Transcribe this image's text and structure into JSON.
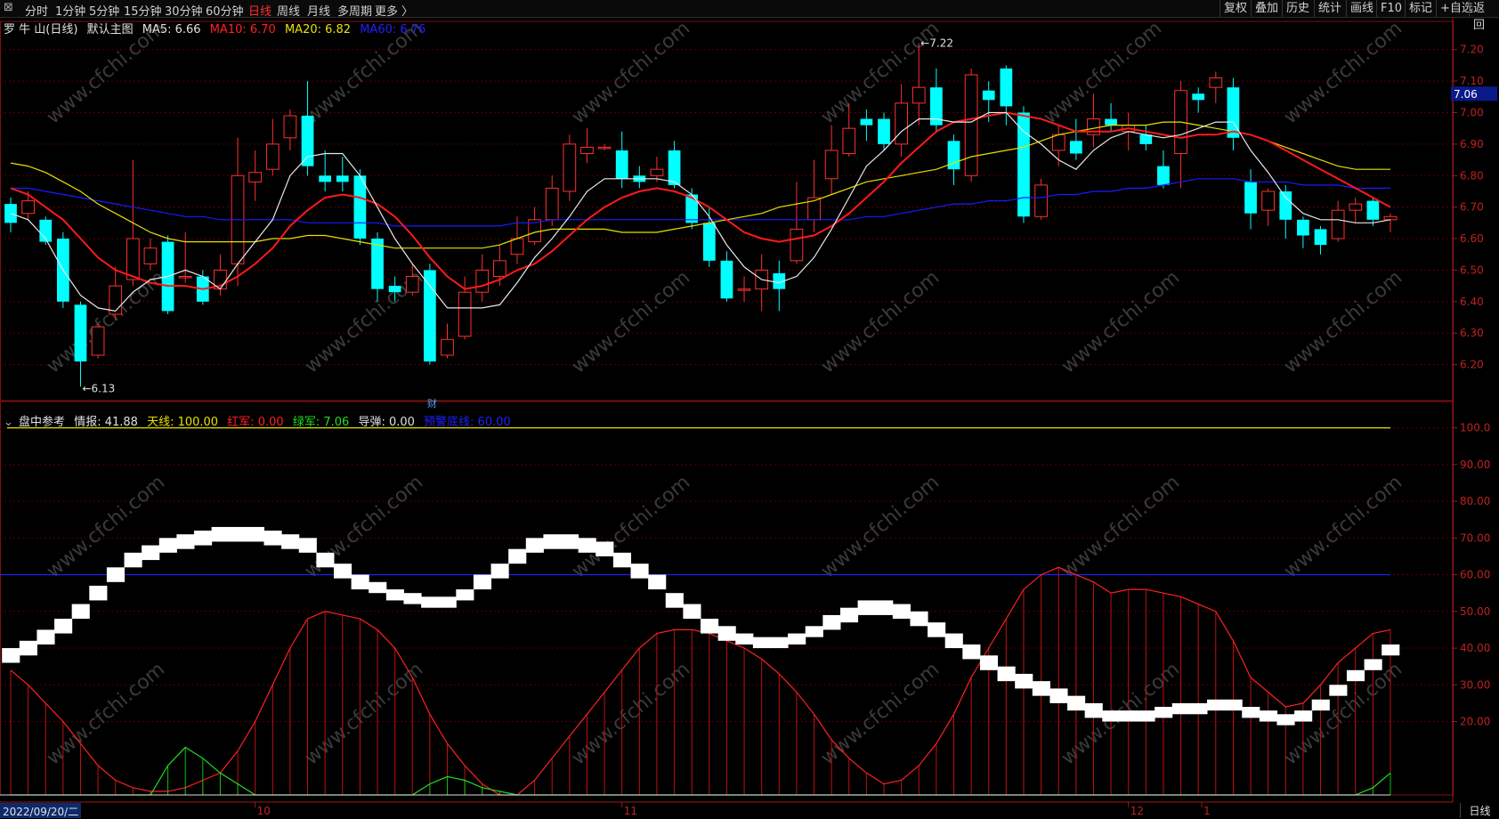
{
  "toolbar": {
    "close_glyph": "⊠",
    "periods": [
      "分时",
      "1分钟",
      "5分钟",
      "15分钟",
      "30分钟",
      "60分钟",
      "日线",
      "周线",
      "月线",
      "多周期",
      "更多 〉"
    ],
    "active_period": "日线",
    "right_buttons": [
      "复权",
      "叠加",
      "历史",
      "统计",
      "画线",
      "F10",
      "标记",
      "+自选",
      "返回"
    ]
  },
  "main_panel": {
    "stock_name": "罗 牛 山(日线)",
    "template_label": "默认主图",
    "ma5": {
      "label": "MA5: 6.66",
      "color": "#e0e0e0"
    },
    "ma10": {
      "label": "MA10: 6.70",
      "color": "#ff2020"
    },
    "ma20": {
      "label": "MA20: 6.82",
      "color": "#e8e000"
    },
    "ma60": {
      "label": "MA60: 6.76",
      "color": "#2020ff"
    },
    "high_marker": "7.22",
    "low_marker": "6.13",
    "price_tag": "7.06",
    "cai_marker": "财",
    "y_ticks": [
      "7.20",
      "7.10",
      "7.00",
      "6.90",
      "6.80",
      "6.70",
      "6.60",
      "6.50",
      "6.40",
      "6.30",
      "6.20"
    ],
    "watermark": "www.cfchi.com"
  },
  "sub_panel": {
    "title": "盘中参考",
    "info": {
      "label": "情报: 41.88",
      "color": "#e0e0e0"
    },
    "sky": {
      "label": "天线: 100.00",
      "color": "#e8e000"
    },
    "red": {
      "label": "红军: 0.00",
      "color": "#ff2020"
    },
    "green": {
      "label": "绿军: 7.06",
      "color": "#20e020"
    },
    "missile": {
      "label": "导弹: 0.00",
      "color": "#e0e0e0"
    },
    "warn": {
      "label": "预警底线: 60.00",
      "color": "#2020ff"
    },
    "y_ticks": [
      "100.0",
      "90.00",
      "80.00",
      "70.00",
      "60.00",
      "50.00",
      "40.00",
      "30.00",
      "20.00"
    ]
  },
  "x_axis": {
    "date_label": "2022/09/20/二",
    "months": [
      "10",
      "11",
      "12",
      "1"
    ],
    "bottom_tab": "日线"
  },
  "chart_data": {
    "type": "candlestick",
    "ylim": [
      6.1,
      7.25
    ],
    "candles": [
      [
        6.71,
        6.65,
        6.73,
        6.62
      ],
      [
        6.68,
        6.72,
        6.75,
        6.66
      ],
      [
        6.66,
        6.59,
        6.67,
        6.58
      ],
      [
        6.6,
        6.4,
        6.62,
        6.38
      ],
      [
        6.39,
        6.21,
        6.4,
        6.13
      ],
      [
        6.23,
        6.32,
        6.33,
        6.22
      ],
      [
        6.36,
        6.45,
        6.51,
        6.34
      ],
      [
        6.47,
        6.6,
        6.85,
        6.45
      ],
      [
        6.52,
        6.57,
        6.6,
        6.5
      ],
      [
        6.59,
        6.37,
        6.61,
        6.36
      ],
      [
        6.48,
        6.48,
        6.62,
        6.46
      ],
      [
        6.48,
        6.4,
        6.5,
        6.39
      ],
      [
        6.44,
        6.5,
        6.55,
        6.42
      ],
      [
        6.52,
        6.8,
        6.92,
        6.45
      ],
      [
        6.78,
        6.81,
        6.88,
        6.72
      ],
      [
        6.82,
        6.9,
        6.98,
        6.8
      ],
      [
        6.92,
        6.99,
        7.01,
        6.88
      ],
      [
        6.99,
        6.83,
        7.1,
        6.8
      ],
      [
        6.8,
        6.78,
        6.88,
        6.75
      ],
      [
        6.8,
        6.78,
        6.86,
        6.75
      ],
      [
        6.8,
        6.6,
        6.82,
        6.58
      ],
      [
        6.6,
        6.44,
        6.62,
        6.4
      ],
      [
        6.45,
        6.43,
        6.48,
        6.4
      ],
      [
        6.43,
        6.48,
        6.52,
        6.42
      ],
      [
        6.5,
        6.21,
        6.52,
        6.2
      ],
      [
        6.23,
        6.28,
        6.33,
        6.22
      ],
      [
        6.29,
        6.43,
        6.48,
        6.28
      ],
      [
        6.43,
        6.5,
        6.55,
        6.4
      ],
      [
        6.48,
        6.53,
        6.58,
        6.45
      ],
      [
        6.55,
        6.6,
        6.67,
        6.52
      ],
      [
        6.59,
        6.66,
        6.7,
        6.58
      ],
      [
        6.66,
        6.76,
        6.8,
        6.64
      ],
      [
        6.75,
        6.9,
        6.93,
        6.72
      ],
      [
        6.87,
        6.89,
        6.95,
        6.84
      ],
      [
        6.89,
        6.89,
        6.9,
        6.88
      ],
      [
        6.88,
        6.79,
        6.94,
        6.76
      ],
      [
        6.8,
        6.78,
        6.83,
        6.76
      ],
      [
        6.8,
        6.82,
        6.86,
        6.78
      ],
      [
        6.88,
        6.77,
        6.91,
        6.76
      ],
      [
        6.74,
        6.65,
        6.76,
        6.63
      ],
      [
        6.65,
        6.53,
        6.7,
        6.51
      ],
      [
        6.53,
        6.41,
        6.56,
        6.4
      ],
      [
        6.44,
        6.44,
        6.48,
        6.4
      ],
      [
        6.44,
        6.5,
        6.55,
        6.37
      ],
      [
        6.49,
        6.44,
        6.53,
        6.37
      ],
      [
        6.53,
        6.63,
        6.78,
        6.52
      ],
      [
        6.66,
        6.73,
        6.85,
        6.62
      ],
      [
        6.79,
        6.88,
        6.96,
        6.74
      ],
      [
        6.87,
        6.95,
        7.03,
        6.86
      ],
      [
        6.98,
        6.96,
        7.01,
        6.91
      ],
      [
        6.98,
        6.9,
        7.0,
        6.88
      ],
      [
        6.9,
        7.03,
        7.09,
        6.86
      ],
      [
        7.03,
        7.08,
        7.22,
        6.96
      ],
      [
        7.08,
        6.96,
        7.14,
        6.94
      ],
      [
        6.91,
        6.82,
        6.93,
        6.77
      ],
      [
        6.8,
        7.12,
        7.14,
        6.78
      ],
      [
        7.07,
        7.04,
        7.1,
        6.97
      ],
      [
        7.14,
        7.02,
        7.15,
        6.96
      ],
      [
        7.0,
        6.67,
        7.02,
        6.65
      ],
      [
        6.67,
        6.77,
        6.79,
        6.66
      ],
      [
        6.88,
        6.93,
        6.96,
        6.83
      ],
      [
        6.91,
        6.87,
        6.98,
        6.85
      ],
      [
        6.93,
        6.98,
        7.06,
        6.89
      ],
      [
        6.98,
        6.96,
        7.03,
        6.94
      ],
      [
        6.94,
        6.96,
        7.0,
        6.88
      ],
      [
        6.93,
        6.9,
        6.96,
        6.88
      ],
      [
        6.83,
        6.77,
        6.88,
        6.76
      ],
      [
        6.87,
        7.07,
        7.1,
        6.76
      ],
      [
        7.06,
        7.04,
        7.08,
        7.0
      ],
      [
        7.08,
        7.11,
        7.13,
        7.03
      ],
      [
        7.08,
        6.92,
        7.11,
        6.88
      ],
      [
        6.78,
        6.68,
        6.82,
        6.63
      ],
      [
        6.69,
        6.75,
        6.76,
        6.64
      ],
      [
        6.75,
        6.66,
        6.77,
        6.6
      ],
      [
        6.66,
        6.61,
        6.67,
        6.57
      ],
      [
        6.63,
        6.58,
        6.64,
        6.55
      ],
      [
        6.6,
        6.69,
        6.72,
        6.59
      ],
      [
        6.69,
        6.71,
        6.73,
        6.65
      ],
      [
        6.72,
        6.66,
        6.73,
        6.64
      ],
      [
        6.66,
        6.67,
        6.68,
        6.62
      ]
    ],
    "ma5": [
      6.68,
      6.66,
      6.6,
      6.5,
      6.42,
      6.38,
      6.37,
      6.43,
      6.47,
      6.48,
      6.5,
      6.48,
      6.44,
      6.52,
      6.59,
      6.66,
      6.8,
      6.86,
      6.87,
      6.87,
      6.8,
      6.7,
      6.6,
      6.52,
      6.45,
      6.38,
      6.38,
      6.38,
      6.39,
      6.46,
      6.54,
      6.6,
      6.67,
      6.75,
      6.79,
      6.79,
      6.79,
      6.79,
      6.78,
      6.74,
      6.67,
      6.58,
      6.51,
      6.47,
      6.46,
      6.48,
      6.54,
      6.63,
      6.73,
      6.83,
      6.88,
      6.94,
      6.98,
      6.98,
      6.97,
      6.97,
      7.0,
      7.0,
      6.94,
      6.9,
      6.85,
      6.82,
      6.88,
      6.92,
      6.94,
      6.93,
      6.92,
      6.93,
      6.95,
      6.97,
      6.97,
      6.88,
      6.81,
      6.73,
      6.68,
      6.66,
      6.66,
      6.65,
      6.65,
      6.66
    ],
    "ma10": [
      6.76,
      6.74,
      6.7,
      6.66,
      6.6,
      6.54,
      6.5,
      6.48,
      6.46,
      6.45,
      6.45,
      6.44,
      6.45,
      6.48,
      6.52,
      6.57,
      6.64,
      6.69,
      6.73,
      6.74,
      6.73,
      6.71,
      6.67,
      6.61,
      6.54,
      6.48,
      6.44,
      6.45,
      6.47,
      6.5,
      6.52,
      6.56,
      6.61,
      6.66,
      6.7,
      6.73,
      6.75,
      6.76,
      6.75,
      6.73,
      6.7,
      6.66,
      6.62,
      6.6,
      6.59,
      6.6,
      6.61,
      6.64,
      6.68,
      6.73,
      6.78,
      6.84,
      6.89,
      6.94,
      6.97,
      6.98,
      6.99,
      7.0,
      6.99,
      6.98,
      6.96,
      6.94,
      6.94,
      6.94,
      6.95,
      6.94,
      6.93,
      6.92,
      6.93,
      6.93,
      6.94,
      6.93,
      6.91,
      6.88,
      6.85,
      6.82,
      6.79,
      6.76,
      6.73,
      6.7
    ],
    "ma20": [
      6.84,
      6.83,
      6.81,
      6.78,
      6.75,
      6.71,
      6.68,
      6.65,
      6.62,
      6.6,
      6.59,
      6.59,
      6.59,
      6.59,
      6.59,
      6.6,
      6.6,
      6.61,
      6.61,
      6.6,
      6.59,
      6.58,
      6.57,
      6.57,
      6.57,
      6.57,
      6.57,
      6.57,
      6.58,
      6.6,
      6.62,
      6.63,
      6.63,
      6.63,
      6.63,
      6.62,
      6.62,
      6.62,
      6.63,
      6.64,
      6.65,
      6.66,
      6.67,
      6.68,
      6.7,
      6.71,
      6.72,
      6.74,
      6.76,
      6.78,
      6.79,
      6.8,
      6.81,
      6.82,
      6.84,
      6.86,
      6.87,
      6.88,
      6.89,
      6.91,
      6.93,
      6.94,
      6.95,
      6.96,
      6.96,
      6.96,
      6.97,
      6.97,
      6.96,
      6.95,
      6.94,
      6.93,
      6.91,
      6.89,
      6.87,
      6.85,
      6.83,
      6.82,
      6.82,
      6.82
    ],
    "ma60": [
      6.76,
      6.76,
      6.75,
      6.74,
      6.73,
      6.72,
      6.71,
      6.7,
      6.69,
      6.68,
      6.67,
      6.67,
      6.66,
      6.66,
      6.66,
      6.66,
      6.66,
      6.65,
      6.65,
      6.65,
      6.65,
      6.65,
      6.64,
      6.64,
      6.64,
      6.64,
      6.64,
      6.64,
      6.64,
      6.65,
      6.65,
      6.66,
      6.66,
      6.66,
      6.66,
      6.66,
      6.66,
      6.66,
      6.66,
      6.66,
      6.66,
      6.66,
      6.66,
      6.66,
      6.66,
      6.66,
      6.66,
      6.66,
      6.66,
      6.67,
      6.67,
      6.68,
      6.69,
      6.7,
      6.71,
      6.71,
      6.72,
      6.72,
      6.73,
      6.73,
      6.74,
      6.74,
      6.75,
      6.75,
      6.76,
      6.76,
      6.77,
      6.78,
      6.79,
      6.79,
      6.79,
      6.78,
      6.78,
      6.78,
      6.77,
      6.77,
      6.77,
      6.76,
      6.76,
      6.76
    ],
    "sub_ylim": [
      0,
      105
    ],
    "band_upper": [
      40,
      42,
      45,
      48,
      52,
      57,
      62,
      66,
      68,
      70,
      71,
      72,
      73,
      73,
      73,
      72,
      71,
      70,
      66,
      63,
      60,
      58,
      56,
      55,
      54,
      54,
      56,
      60,
      63,
      67,
      70,
      71,
      71,
      70,
      69,
      66,
      63,
      60,
      55,
      52,
      48,
      46,
      44,
      43,
      43,
      44,
      46,
      49,
      51,
      53,
      53,
      52,
      50,
      47,
      44,
      41,
      38,
      35,
      33,
      31,
      29,
      27,
      25,
      23,
      23,
      23,
      24,
      25,
      25,
      26,
      26,
      24,
      23,
      22,
      23,
      26,
      30,
      34,
      37,
      41
    ],
    "band_lower": [
      36,
      38,
      41,
      44,
      48,
      53,
      58,
      62,
      64,
      66,
      67,
      68,
      69,
      69,
      69,
      68,
      67,
      66,
      62,
      59,
      56,
      55,
      53,
      52,
      51,
      51,
      53,
      56,
      59,
      63,
      66,
      67,
      67,
      66,
      65,
      62,
      59,
      56,
      51,
      48,
      44,
      42,
      41,
      40,
      40,
      41,
      43,
      45,
      47,
      49,
      49,
      48,
      46,
      43,
      40,
      37,
      34,
      31,
      29,
      27,
      25,
      23,
      21,
      20,
      20,
      20,
      21,
      22,
      22,
      23,
      23,
      21,
      20,
      19,
      20,
      23,
      27,
      31,
      34,
      38
    ],
    "red_line": [
      34,
      30,
      25,
      20,
      14,
      8,
      4,
      2,
      1,
      1,
      2,
      4,
      6,
      12,
      20,
      30,
      40,
      48,
      50,
      49,
      48,
      45,
      40,
      32,
      22,
      14,
      8,
      3,
      0,
      0,
      4,
      10,
      16,
      22,
      28,
      34,
      40,
      44,
      45,
      45,
      44,
      42,
      40,
      37,
      33,
      28,
      22,
      15,
      10,
      6,
      3,
      4,
      8,
      14,
      22,
      32,
      40,
      48,
      56,
      60,
      62,
      60,
      58,
      55,
      56,
      56,
      55,
      54,
      52,
      50,
      42,
      32,
      28,
      24,
      25,
      30,
      36,
      40,
      44,
      45
    ],
    "green_line": [
      0,
      0,
      0,
      0,
      0,
      0,
      0,
      0,
      0,
      8,
      13,
      10,
      6,
      3,
      0,
      0,
      0,
      0,
      0,
      0,
      0,
      0,
      0,
      0,
      3,
      5,
      4,
      2,
      1,
      0,
      0,
      0,
      0,
      0,
      0,
      0,
      0,
      0,
      0,
      0,
      0,
      0,
      0,
      0,
      0,
      0,
      0,
      0,
      0,
      0,
      0,
      0,
      0,
      0,
      0,
      0,
      0,
      0,
      0,
      0,
      0,
      0,
      0,
      0,
      0,
      0,
      0,
      0,
      0,
      0,
      0,
      0,
      0,
      0,
      0,
      0,
      0,
      0,
      2,
      6
    ],
    "sky_line": 100,
    "warn_line": 60
  },
  "colors": {
    "up": "#ff3030",
    "down": "#00ffff",
    "grid": "#5a0000",
    "axis": "#8a1010"
  }
}
